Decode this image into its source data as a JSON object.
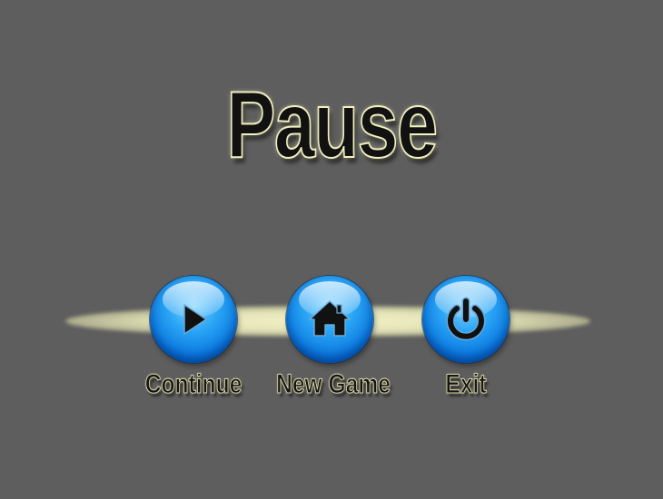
{
  "title": "Pause",
  "menu": {
    "items": [
      {
        "label": "Continue",
        "icon": "play-icon"
      },
      {
        "label": "New Game",
        "icon": "home-icon"
      },
      {
        "label": "Exit",
        "icon": "power-icon"
      }
    ]
  },
  "colors": {
    "background": "#5e5e5e",
    "button_blue": "#1e90ff",
    "glow": "#f0f0c8",
    "text_outline": "#f2f0c0",
    "text_fill": "#111111"
  }
}
